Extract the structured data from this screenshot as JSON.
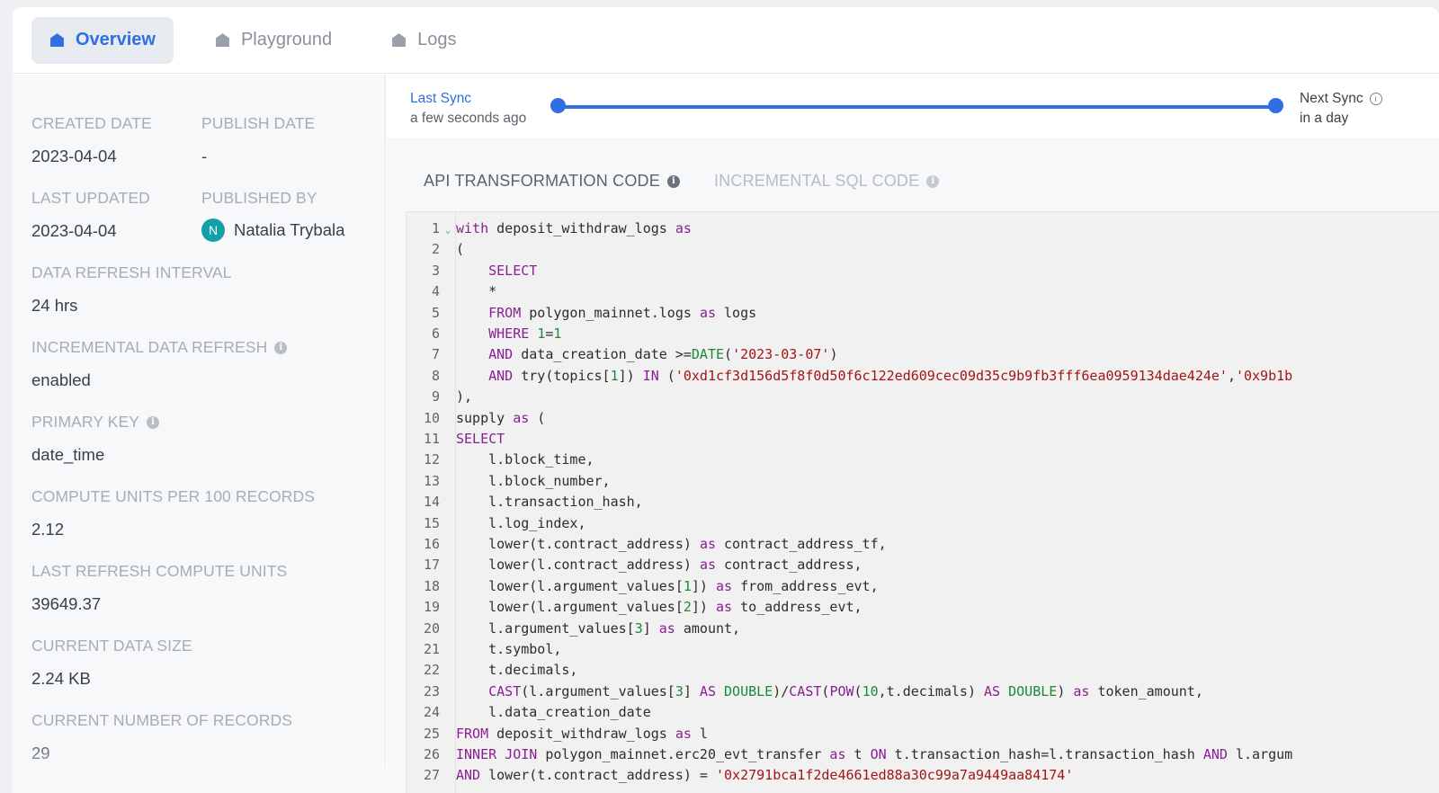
{
  "tabs": [
    {
      "label": "Overview",
      "icon": "home-icon",
      "active": true
    },
    {
      "label": "Playground",
      "icon": "home-icon",
      "active": false
    },
    {
      "label": "Logs",
      "icon": "home-icon",
      "active": false
    }
  ],
  "meta": {
    "created_date_label": "CREATED DATE",
    "created_date": "2023-04-04",
    "publish_date_label": "PUBLISH DATE",
    "publish_date": "-",
    "last_updated_label": "LAST UPDATED",
    "last_updated": "2023-04-04",
    "published_by_label": "PUBLISHED BY",
    "published_by_initial": "N",
    "published_by": "Natalia Trybala",
    "refresh_interval_label": "DATA REFRESH INTERVAL",
    "refresh_interval": "24 hrs",
    "incremental_label": "INCREMENTAL DATA REFRESH",
    "incremental": "enabled",
    "primary_key_label": "PRIMARY KEY",
    "primary_key": "date_time",
    "compute_units_label": "COMPUTE UNITS PER 100 RECORDS",
    "compute_units": "2.12",
    "last_refresh_cu_label": "LAST REFRESH COMPUTE UNITS",
    "last_refresh_cu": "39649.37",
    "data_size_label": "CURRENT DATA SIZE",
    "data_size": "2.24 KB",
    "num_records_label": "CURRENT NUMBER OF RECORDS",
    "num_records": "29"
  },
  "sync": {
    "last_label": "Last Sync",
    "last_value": "a few seconds ago",
    "next_label": "Next Sync",
    "next_value": "in a day"
  },
  "code_tabs": {
    "api": "API TRANSFORMATION CODE",
    "incremental": "INCREMENTAL SQL CODE"
  },
  "code_lines": [
    "with deposit_withdraw_logs as",
    "(",
    "    SELECT",
    "    *",
    "    FROM polygon_mainnet.logs as logs",
    "    WHERE 1=1",
    "    AND data_creation_date >=DATE('2023-03-07')",
    "    AND try(topics[1]) IN ('0xd1cf3d156d5f8f0d50f6c122ed609cec09d35c9b9fb3fff6ea0959134dae424e','0x9b1b",
    "),",
    "supply as (",
    "SELECT",
    "    l.block_time,",
    "    l.block_number,",
    "    l.transaction_hash,",
    "    l.log_index,",
    "    lower(t.contract_address) as contract_address_tf,",
    "    lower(l.contract_address) as contract_address,",
    "    lower(l.argument_values[1]) as from_address_evt,",
    "    lower(l.argument_values[2]) as to_address_evt,",
    "    l.argument_values[3] as amount,",
    "    t.symbol,",
    "    t.decimals,",
    "    CAST(l.argument_values[3] AS DOUBLE)/CAST(POW(10,t.decimals) AS DOUBLE) as token_amount,",
    "    l.data_creation_date",
    "FROM deposit_withdraw_logs as l",
    "INNER JOIN polygon_mainnet.erc20_evt_transfer as t ON t.transaction_hash=l.transaction_hash AND l.argum",
    "AND lower(t.contract_address) = '0x2791bca1f2de4661ed88a30c99a7a9449aa84174'"
  ]
}
